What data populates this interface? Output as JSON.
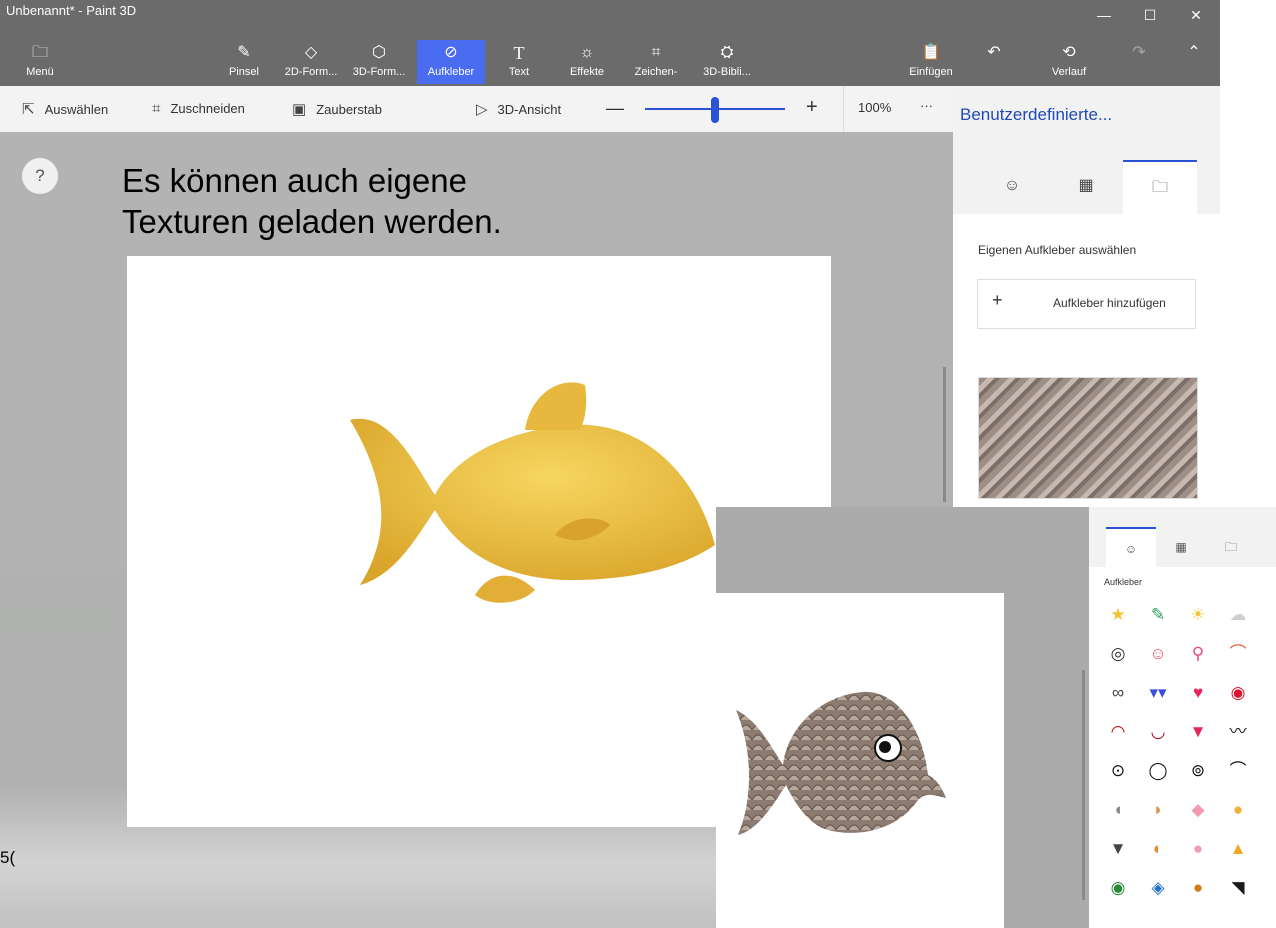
{
  "window": {
    "title": "Unbenannt* - Paint 3D"
  },
  "window_controls": [
    "—",
    "☐",
    "✕"
  ],
  "ribbon": {
    "menu": "Menü",
    "tools": [
      "Pinsel",
      "2D-Form...",
      "3D-Form...",
      "Aufkleber",
      "Text",
      "Effekte",
      "Zeichen-",
      "3D-Bibli..."
    ],
    "active_tool": "Aufkleber",
    "paste": "Einfügen",
    "history": "Verlauf"
  },
  "toolbar": {
    "select": "Auswählen",
    "crop": "Zuschneiden",
    "magic_select": "Zauberstab",
    "view_3d": "3D-Ansicht",
    "zoom": "100%",
    "more": "···",
    "zoom_level_fraction": 0.5
  },
  "side_panel": {
    "title": "Benutzerdefinierte...",
    "heading": "Eigenen Aufkleber auswählen",
    "add_button": "Aufkleber hinzufügen"
  },
  "canvas": {
    "help": "?",
    "caption_line1": "Es können auch eigene",
    "caption_line2": "Texturen geladen werden.",
    "left_edge_label": "5("
  },
  "inset": {
    "heading": "Aufkleber",
    "stickers": [
      [
        "★",
        "✎",
        "☀",
        "☁"
      ],
      [
        "◎",
        "☺",
        "⚲",
        "⌒"
      ],
      [
        "∞",
        "▾▾",
        "♥",
        "◉"
      ],
      [
        "◠",
        "◡",
        "▼",
        "〰"
      ],
      [
        "⊙",
        "◯",
        "⊚",
        "⌒"
      ],
      [
        "◖",
        "◗",
        "◆",
        "●"
      ],
      [
        "▼",
        "◐",
        "●",
        "▲"
      ],
      [
        "◉",
        "◈",
        "●",
        "◥"
      ]
    ],
    "sticker_colors": [
      [
        "#f4c430",
        "#2e9c5c",
        "#f7c33a",
        "#cfcfcf"
      ],
      [
        "#333333",
        "#e34b68",
        "#e84a7f",
        "#e5603c"
      ],
      [
        "#444444",
        "#3a4fd8",
        "#e8245f",
        "#d9152b"
      ],
      [
        "#d00000",
        "#b00020",
        "#e8245f",
        "#111111"
      ],
      [
        "#111111",
        "#111111",
        "#111111",
        "#111111"
      ],
      [
        "#888888",
        "#e0934f",
        "#f39cb0",
        "#f0b13c"
      ],
      [
        "#444444",
        "#e08a3c",
        "#f49ab8",
        "#f4a91e"
      ],
      [
        "#2a8a3c",
        "#1e73c9",
        "#d07f12",
        "#1a1a1a"
      ]
    ]
  }
}
